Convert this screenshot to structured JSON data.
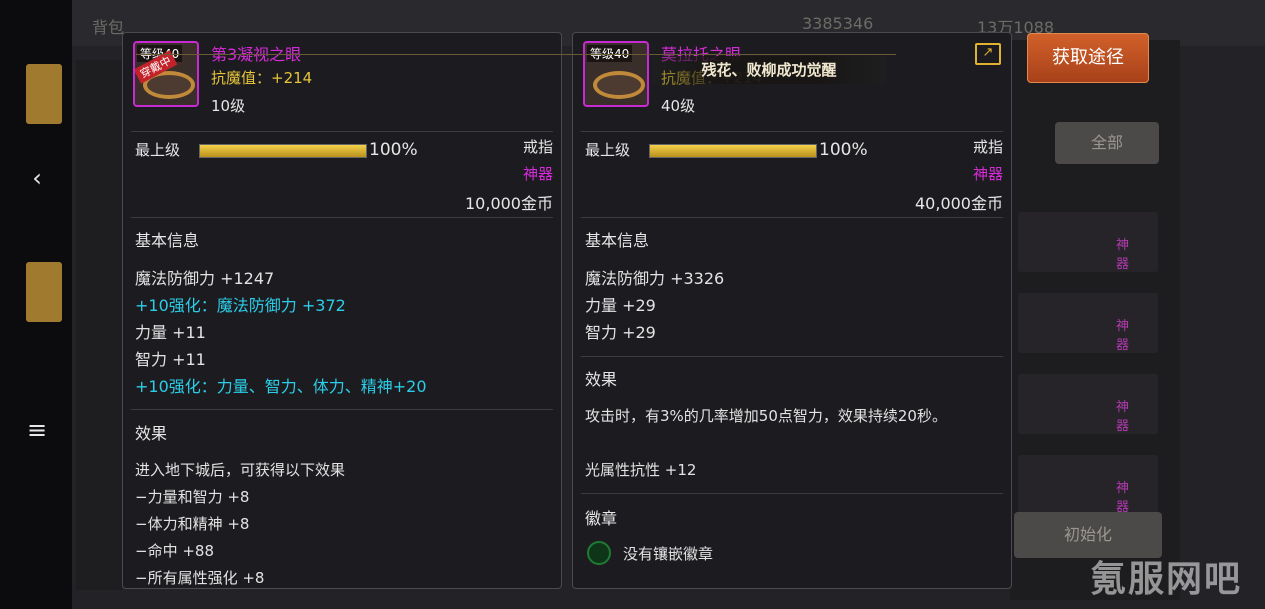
{
  "nav": {
    "back": "‹",
    "home": "▢",
    "menu": "≡"
  },
  "background": {
    "title": "背包",
    "top_a": "3385346",
    "top_b": "13万1088",
    "tab_all": "全部",
    "tab_init": "初始化",
    "grade_tags": [
      "神器",
      "神器",
      "神器",
      "神器"
    ]
  },
  "left_item": {
    "level_badge": "等级40",
    "equipped_badge": "穿戴中",
    "name": "第3凝视之眼",
    "stat": "抗魔值：+214",
    "level": "10级",
    "max_label": "最上级",
    "progress_pct": 100,
    "progress_text": "100%",
    "type": "戒指",
    "grade": "神器",
    "price": "10,000金币",
    "basic_title": "基本信息",
    "basic_lines": [
      {
        "text": "魔法防御力 +1247",
        "cyan": false
      },
      {
        "text": "+10强化：魔法防御力 +372",
        "cyan": true
      },
      {
        "text": "力量 +11",
        "cyan": false
      },
      {
        "text": "智力 +11",
        "cyan": false
      },
      {
        "text": "+10强化：力量、智力、体力、精神+20",
        "cyan": true
      }
    ],
    "effect_title": "效果",
    "effect_lines": [
      "进入地下城后，可获得以下效果",
      "−力量和智力 +8",
      "−体力和精神 +8",
      "−命中 +88",
      "−所有属性强化 +8"
    ]
  },
  "right_item": {
    "level_badge": "等级40",
    "name": "莫拉托之眼",
    "stat": "抗魔值：+214",
    "level": "40级",
    "max_label": "最上级",
    "progress_pct": 100,
    "progress_text": "100%",
    "type": "戒指",
    "grade": "神器",
    "price": "40,000金币",
    "basic_title": "基本信息",
    "basic_lines": [
      "魔法防御力 +3326",
      "力量 +29",
      "智力 +29"
    ],
    "effect_title": "效果",
    "effect_text": "攻击时，有3%的几率增加50点智力，效果持续20秒。",
    "resist_line": "光属性抗性 +12",
    "emblem_title": "徽章",
    "emblem_text": "没有镶嵌徽章"
  },
  "toast": {
    "text": "残花、败柳成功觉醒"
  },
  "get_button": {
    "label": "获取途径"
  },
  "watermark": {
    "text": "氪服网吧"
  },
  "colors": {
    "epic": "#d62bd8",
    "gold": "#e6c53a",
    "cyan": "#2ccde8",
    "button": "#c0531f"
  }
}
